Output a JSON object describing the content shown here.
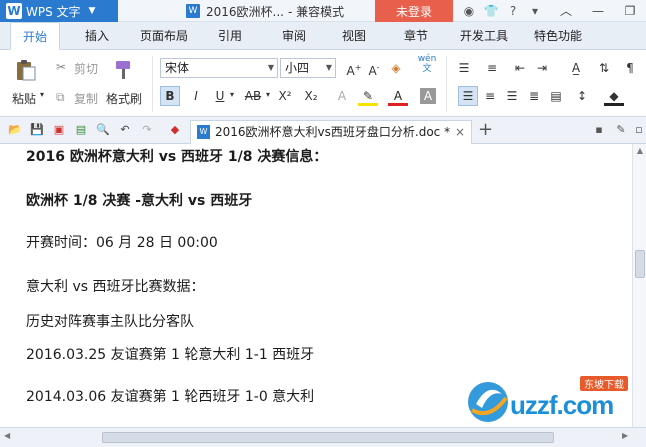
{
  "app": {
    "menu_label": "WPS 文字",
    "doc_title": "2016欧洲杯...",
    "mode": "- 兼容模式",
    "login_label": "未登录"
  },
  "tabs": [
    "开始",
    "插入",
    "页面布局",
    "引用",
    "审阅",
    "视图",
    "章节",
    "开发工具",
    "特色功能"
  ],
  "ribbon": {
    "paste_label": "粘贴",
    "cut_label": "剪切",
    "copy_label": "复制",
    "format_painter_label": "格式刷",
    "font_name": "宋体",
    "font_size": "小四",
    "wen_label": "wén",
    "bold": "B",
    "italic": "I",
    "underline": "U",
    "strike": "AB",
    "superscript": "X²",
    "subscript": "X₂"
  },
  "doc_tab": {
    "title": "2016欧洲杯意大利vs西班牙盘口分析.doc *"
  },
  "document": {
    "lines": [
      "2016 欧洲杯意大利 vs 西班牙 1/8 决赛信息：",
      "欧洲杯 1/8 决赛 -意大利 vs 西班牙",
      "开赛时间：06 月 28 日 00:00",
      "意大利 vs 西班牙比赛数据：",
      "历史对阵赛事主队比分客队",
      "2016.03.25 友谊赛第 1 轮意大利 1-1 西班牙",
      "2014.03.06 友谊赛第 1 轮西班牙 1-0 意大利"
    ]
  },
  "watermark": {
    "brand": "uzzf.com",
    "tag": "东坡下载"
  },
  "colors": {
    "accent": "#2a7bd0",
    "login": "#e8604c"
  }
}
